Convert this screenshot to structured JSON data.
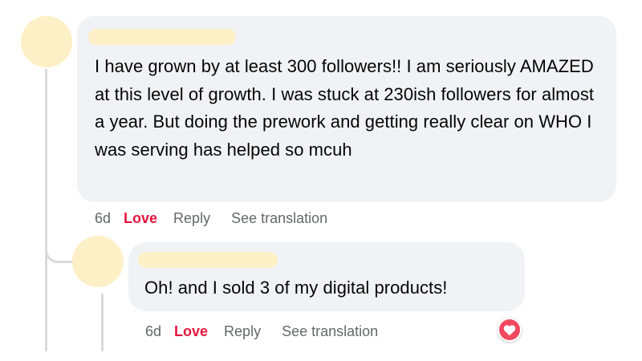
{
  "main_comment": {
    "text": "I have grown by at least 300 followers!! I am seriously AMAZED at this level of growth. I was stuck at 230ish followers for almost a year. But doing the prework and getting really clear on WHO I was serving has helped so mcuh",
    "time": "6d",
    "love_label": "Love",
    "reply_label": "Reply",
    "translate_label": "See translation"
  },
  "reply_comment": {
    "text": "Oh! and I sold 3 of my digital products!",
    "time": "6d",
    "love_label": "Love",
    "reply_label": "Reply",
    "translate_label": "See translation",
    "reaction_icon": "heart-icon"
  },
  "colors": {
    "bubble_bg": "#f0f2f5",
    "love_red": "#e4163d",
    "meta_gray": "#65676b",
    "avatar_placeholder": "#fdf0c6",
    "heart_reaction": "#f0495f"
  }
}
